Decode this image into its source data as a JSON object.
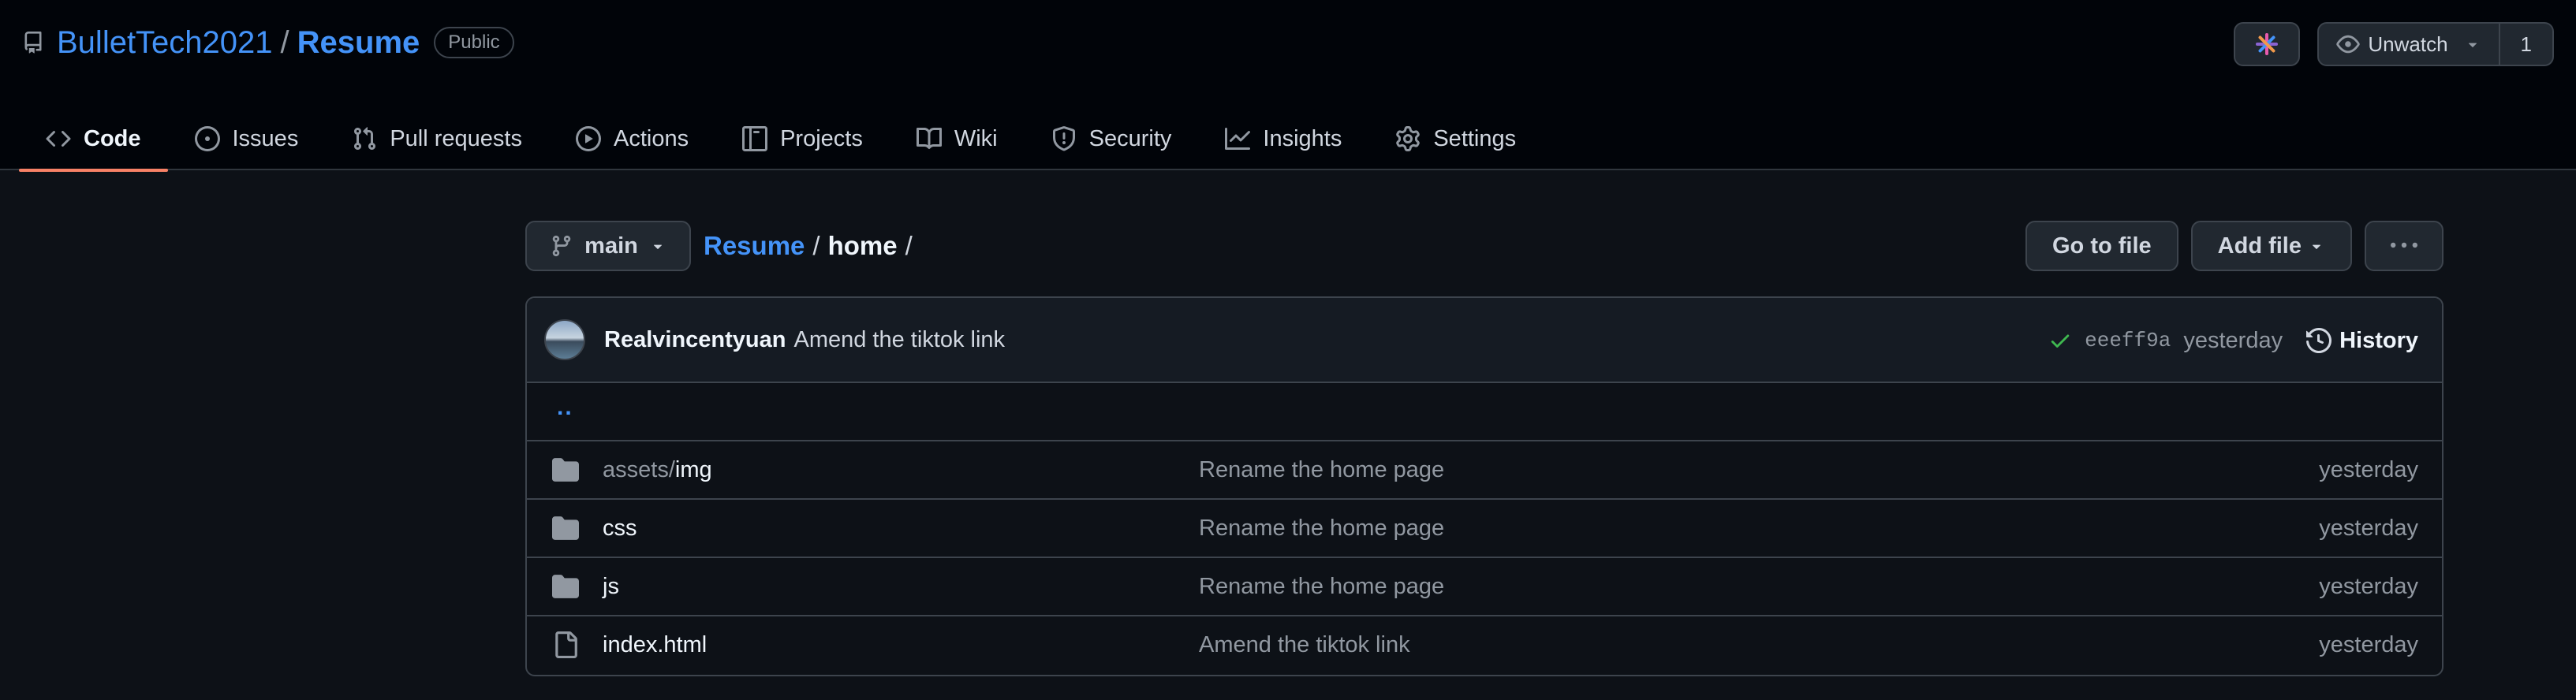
{
  "repo": {
    "owner": "BulletTech2021",
    "separator": "/",
    "name": "Resume",
    "visibility": "Public"
  },
  "top_actions": {
    "copilot_icon": "copilot-sparkle-icon",
    "unwatch_label": "Unwatch",
    "watch_count": "1"
  },
  "tabs": [
    {
      "label": "Code",
      "icon": "code-icon",
      "active": true
    },
    {
      "label": "Issues",
      "icon": "issue-circle-icon"
    },
    {
      "label": "Pull requests",
      "icon": "pull-request-icon"
    },
    {
      "label": "Actions",
      "icon": "play-icon"
    },
    {
      "label": "Projects",
      "icon": "table-icon"
    },
    {
      "label": "Wiki",
      "icon": "book-icon"
    },
    {
      "label": "Security",
      "icon": "shield-icon"
    },
    {
      "label": "Insights",
      "icon": "graph-icon"
    },
    {
      "label": "Settings",
      "icon": "gear-icon"
    }
  ],
  "toolbar": {
    "branch": "main",
    "breadcrumb_root": "Resume",
    "breadcrumb_sep": "/",
    "breadcrumb_current": "home",
    "breadcrumb_trail": "/",
    "go_to_file": "Go to file",
    "add_file": "Add file",
    "more": "···"
  },
  "latest_commit": {
    "author": "Realvincentyuan",
    "message": "Amend the tiktok link",
    "sha": "eeeff9a",
    "time": "yesterday",
    "history_label": "History",
    "status": "success"
  },
  "parent_dir": "..",
  "files": [
    {
      "type": "folder",
      "name_prefix": "assets/",
      "name": "img",
      "message": "Rename the home page",
      "time": "yesterday"
    },
    {
      "type": "folder",
      "name_prefix": "",
      "name": "css",
      "message": "Rename the home page",
      "time": "yesterday"
    },
    {
      "type": "folder",
      "name_prefix": "",
      "name": "js",
      "message": "Rename the home page",
      "time": "yesterday"
    },
    {
      "type": "file",
      "name_prefix": "",
      "name": "index.html",
      "message": "Amend the tiktok link",
      "time": "yesterday"
    }
  ],
  "colors": {
    "accent_link": "#4493f8",
    "active_tab_underline": "#f78166",
    "success": "#3fb950"
  }
}
